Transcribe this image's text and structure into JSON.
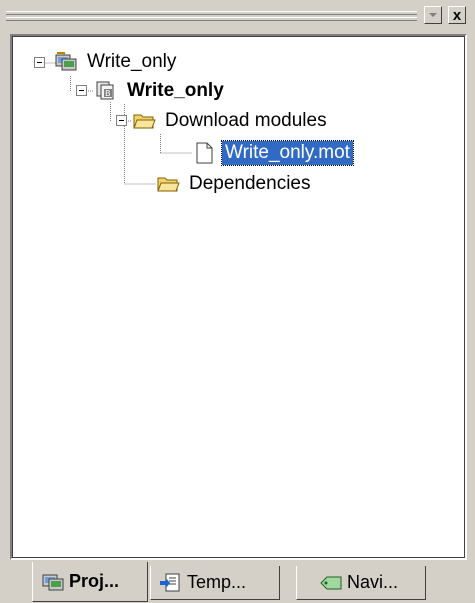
{
  "window": {
    "menu_icon": "dropdown-arrow-icon",
    "close_glyph": "x"
  },
  "tree": {
    "root": {
      "label": "Write_only",
      "icon": "workspace-icon",
      "expanded": true
    },
    "project": {
      "label": "Write_only",
      "icon": "project-icon",
      "expanded": true,
      "bold": true
    },
    "download_folder": {
      "label": "Download modules",
      "icon": "folder-open-icon",
      "expanded": true
    },
    "file": {
      "label": "Write_only.mot",
      "icon": "document-icon",
      "selected": true
    },
    "dependencies": {
      "label": "Dependencies",
      "icon": "folder-open-icon"
    }
  },
  "tabs": [
    {
      "label": "Proj...",
      "icon": "workspace-icon",
      "active": true
    },
    {
      "label": "Temp...",
      "icon": "template-icon",
      "active": false
    },
    {
      "label": "Navi...",
      "icon": "navigation-tag-icon",
      "active": false
    }
  ],
  "colors": {
    "selection": "#316ac5",
    "face": "#d4d0c8",
    "folder": "#f2d46b"
  }
}
